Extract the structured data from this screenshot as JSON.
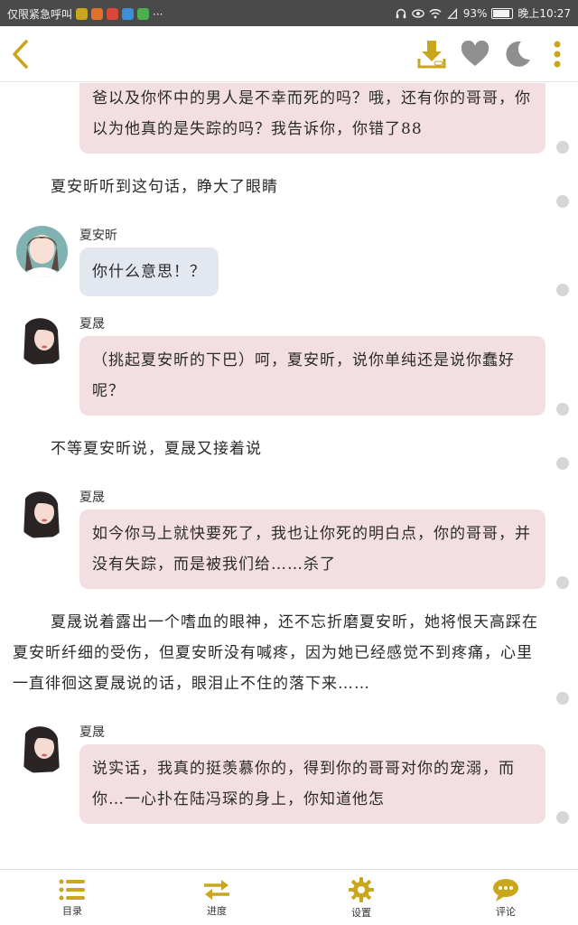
{
  "colors": {
    "accent": "#c9a61c",
    "villain_bubble": "#f3dfe1",
    "heroine_bubble": "#e3e8f0",
    "icon_gray": "#8f8f8f",
    "statusbar": "#4a4a4a"
  },
  "status_bar": {
    "carrier": "仅限紧急呼叫",
    "battery": "93%",
    "battery_level": 0.93,
    "time": "晚上10:27",
    "more": "···"
  },
  "toolbar": {
    "back_icon": "chevron-left-icon",
    "download_icon": "download-icon",
    "favorite_icon": "heart-icon",
    "night_mode_icon": "moon-icon",
    "more_icon": "more-vertical-icon"
  },
  "feed": [
    {
      "type": "bubble",
      "role": "villain",
      "speaker": "",
      "avatar": "none",
      "text": "爸以及你怀中的男人是不幸而死的吗？哦，还有你的哥哥，你以为他真的是失踪的吗？我告诉你，你错了88"
    },
    {
      "type": "narration",
      "text": "夏安昕听到这句话，睁大了眼睛"
    },
    {
      "type": "bubble",
      "role": "heroine",
      "speaker": "夏安昕",
      "avatar": "heroine",
      "text": "你什么意思！？"
    },
    {
      "type": "bubble",
      "role": "villain",
      "speaker": "夏晟",
      "avatar": "villain",
      "text": "（挑起夏安昕的下巴）呵，夏安昕，说你单纯还是说你蠢好呢？"
    },
    {
      "type": "narration",
      "text": "不等夏安昕说，夏晟又接着说"
    },
    {
      "type": "bubble",
      "role": "villain",
      "speaker": "夏晟",
      "avatar": "villain",
      "text": "如今你马上就快要死了，我也让你死的明白点，你的哥哥，并没有失踪，而是被我们给……杀了"
    },
    {
      "type": "narration",
      "text": "夏晟说着露出一个嗜血的眼神，还不忘折磨夏安昕，她将恨天高踩在夏安昕纤细的受伤，但夏安昕没有喊疼，因为她已经感觉不到疼痛，心里一直徘徊这夏晟说的话，眼泪止不住的落下来……"
    },
    {
      "type": "bubble",
      "role": "villain",
      "speaker": "夏晟",
      "avatar": "villain",
      "text": "说实话，我真的挺羡慕你的，得到你的哥哥对你的宠溺，而你…一心扑在陆冯琛的身上，你知道他怎"
    }
  ],
  "bottom_nav": [
    {
      "label": "目录",
      "icon": "list-icon"
    },
    {
      "label": "进度",
      "icon": "swap-arrows-icon"
    },
    {
      "label": "设置",
      "icon": "gear-icon"
    },
    {
      "label": "评论",
      "icon": "comment-bubble-icon"
    }
  ]
}
